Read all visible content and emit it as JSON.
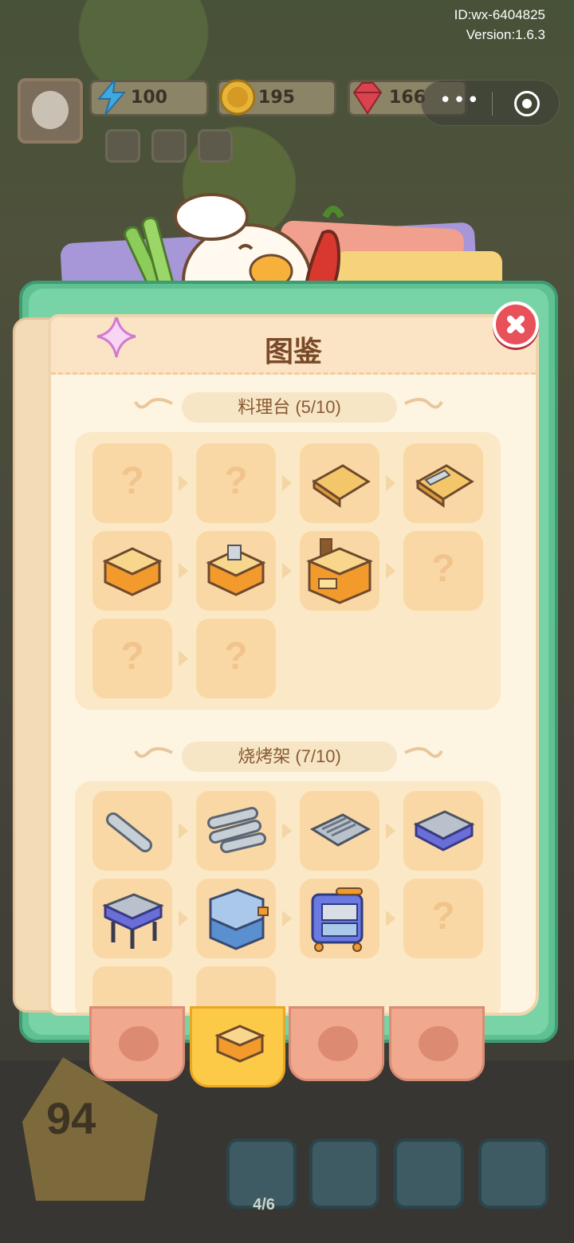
{
  "header": {
    "id_text": "ID:wx-6404825",
    "version_text": "Version:1.6.3"
  },
  "resources": {
    "energy": "100",
    "coins": "195",
    "gems": "166"
  },
  "capsule": {
    "dots": "•••"
  },
  "book": {
    "title": "图鉴",
    "sections": [
      {
        "title": "料理台 (5/10)",
        "unknown_mark": "?"
      },
      {
        "title": "烧烤架 (7/10)",
        "unknown_mark": "?"
      }
    ]
  },
  "bottom": {
    "level": "94",
    "gift_progress": "4/6"
  },
  "colors": {
    "accent": "#fcca47",
    "close": "#e8505a",
    "book_green": "#5fc192",
    "page": "#fdf4e1"
  }
}
